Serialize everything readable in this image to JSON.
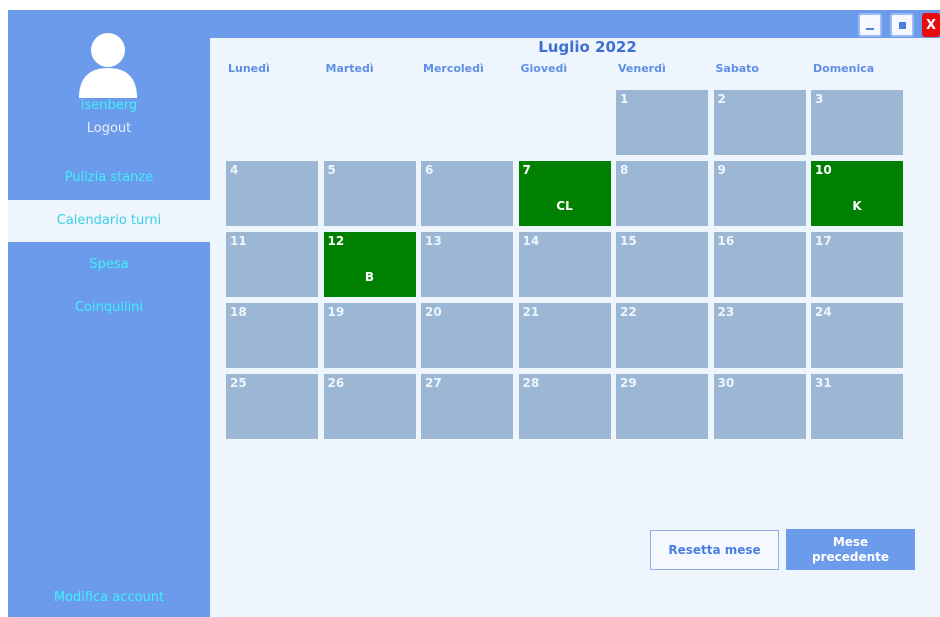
{
  "window": {
    "controls": {
      "minimize_icon": "minimize-icon",
      "maximize_icon": "maximize-icon",
      "close_label": "X"
    }
  },
  "sidebar": {
    "avatar_icon": "user-avatar-icon",
    "username": "isenberg",
    "logout": "Logout",
    "nav": [
      {
        "label": "Pulizia stanze",
        "active": false
      },
      {
        "label": "Calendario turni",
        "active": true
      },
      {
        "label": "Spesa",
        "active": false
      },
      {
        "label": "Coinquilini",
        "active": false
      }
    ],
    "modify_account": "Modifica account"
  },
  "calendar": {
    "title": "Luglio 2022",
    "weekdays": [
      "Lunedì",
      "Martedì",
      "Mercoledì",
      "Giovedì",
      "Venerdì",
      "Sabato",
      "Domenica"
    ],
    "first_weekday_index": 4,
    "days_in_month": 31,
    "turns": [
      {
        "day": "7",
        "code": "CL"
      },
      {
        "day": "10",
        "code": "K"
      },
      {
        "day": "12",
        "code": "B"
      }
    ],
    "colors": {
      "empty_cell": "#9bb7d4",
      "turn_cell": "#008000"
    }
  },
  "actions": {
    "reset_month": "Resetta mese",
    "previous_month": "Mese precedente"
  }
}
